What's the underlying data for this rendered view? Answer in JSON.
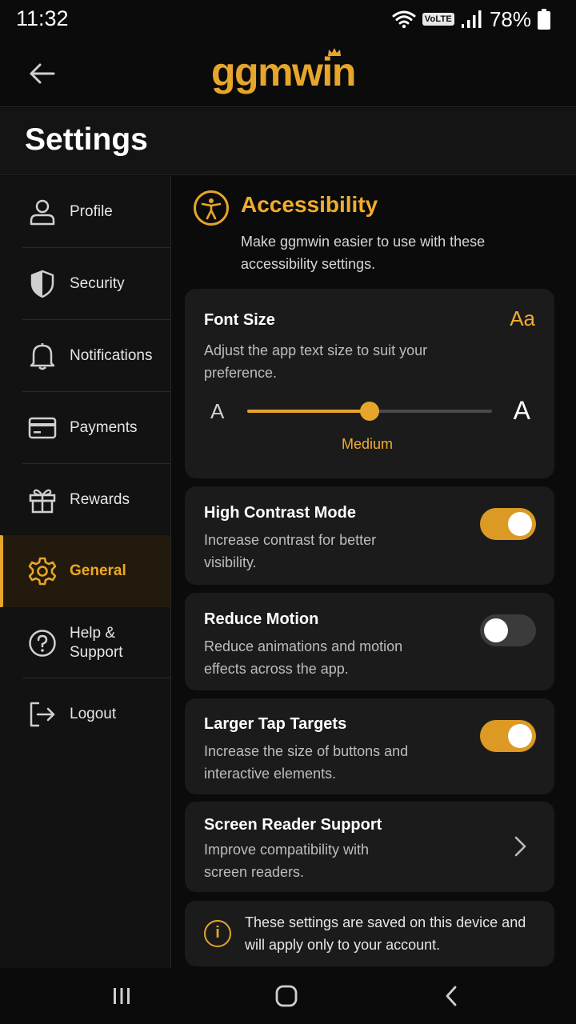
{
  "status_bar": {
    "time": "11:32",
    "network_badge": "VoLTE",
    "battery": "78%"
  },
  "header": {
    "logo": "ggmwin",
    "back_icon": "arrow-left-icon"
  },
  "page": {
    "title": "Settings"
  },
  "sidebar": {
    "items": [
      {
        "label": "Profile",
        "icon": "user-icon",
        "active": false
      },
      {
        "label": "Security",
        "icon": "shield-icon",
        "active": false
      },
      {
        "label": "Notifications",
        "icon": "bell-icon",
        "active": false
      },
      {
        "label": "Payments",
        "icon": "credit-card-icon",
        "active": false
      },
      {
        "label": "Rewards",
        "icon": "gift-icon",
        "active": false
      },
      {
        "label": "General",
        "icon": "gear-icon",
        "active": true
      },
      {
        "label": "Help & Support",
        "icon": "help-circle-icon",
        "active": false
      },
      {
        "label": "Logout",
        "icon": "logout-icon",
        "active": false
      }
    ]
  },
  "section": {
    "icon": "accessibility-icon",
    "title": "Accessibility",
    "description": "Make ggmwin easier to use with these accessibility settings."
  },
  "font_size": {
    "title": "Font Size",
    "badge": "Aa",
    "description": "Adjust the app text size to suit your preference.",
    "min_label": "A",
    "max_label": "A",
    "value_label": "Medium",
    "value_fraction": 0.5
  },
  "toggles": [
    {
      "title": "High Contrast Mode",
      "description": "Increase contrast for better visibility.",
      "on": true
    },
    {
      "title": "Reduce Motion",
      "description": "Reduce animations and motion effects across the app.",
      "on": false
    },
    {
      "title": "Larger Tap Targets",
      "description": "Increase the size of buttons and interactive elements.",
      "on": true
    }
  ],
  "screen_reader": {
    "title": "Screen Reader Support",
    "description": "Improve compatibility with screen readers.",
    "icon": "chevron-right-icon"
  },
  "info": {
    "icon": "info-icon",
    "text": "These settings are saved on this device and will apply only to your account."
  },
  "colors": {
    "accent": "#e6a52b",
    "background": "#0b0b0b",
    "card": "#1b1b1b"
  }
}
